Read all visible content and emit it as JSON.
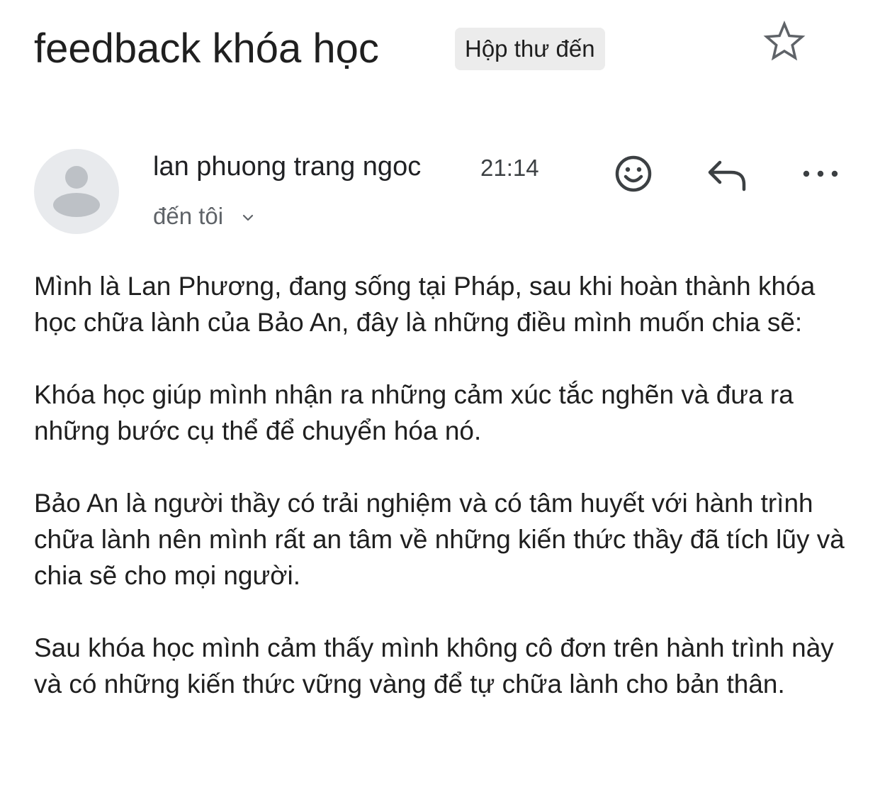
{
  "email": {
    "subject": "feedback khóa học",
    "label": "Hộp thư đến",
    "sender_name": "lan phuong trang ngoc",
    "time": "21:14",
    "recipient": "đến tôi",
    "icons": {
      "star": "star-icon",
      "emoji": "smiley-icon",
      "reply": "reply-icon",
      "more": "more-horizontal-icon",
      "chevron": "chevron-down-icon",
      "avatar": "default-avatar-icon"
    },
    "paragraphs": [
      "Mình là Lan Phương, đang sống tại Pháp, sau khi hoàn thành khóa học chữa lành của Bảo An, đây là những điều mình muốn chia sẽ:",
      "Khóa học giúp mình nhận ra những cảm xúc tắc nghẽn và đưa ra những bước cụ thể để chuyển hóa nó.",
      "Bảo An là người thầy có trải nghiệm và có tâm huyết với hành trình chữa lành nên mình rất an tâm về những kiến thức thầy đã tích lũy và chia sẽ cho mọi người.",
      "Sau khóa học mình cảm thấy mình không cô đơn trên hành trình này và có những kiến thức vững vàng để tự chữa lành cho bản thân."
    ]
  },
  "colors": {
    "text": "#1f1f1f",
    "secondary_text": "#5f6368",
    "chip_bg": "#ececec",
    "avatar_bg": "#e8eaed",
    "avatar_fg": "#bdc1c6",
    "icon": "#3c4043"
  }
}
